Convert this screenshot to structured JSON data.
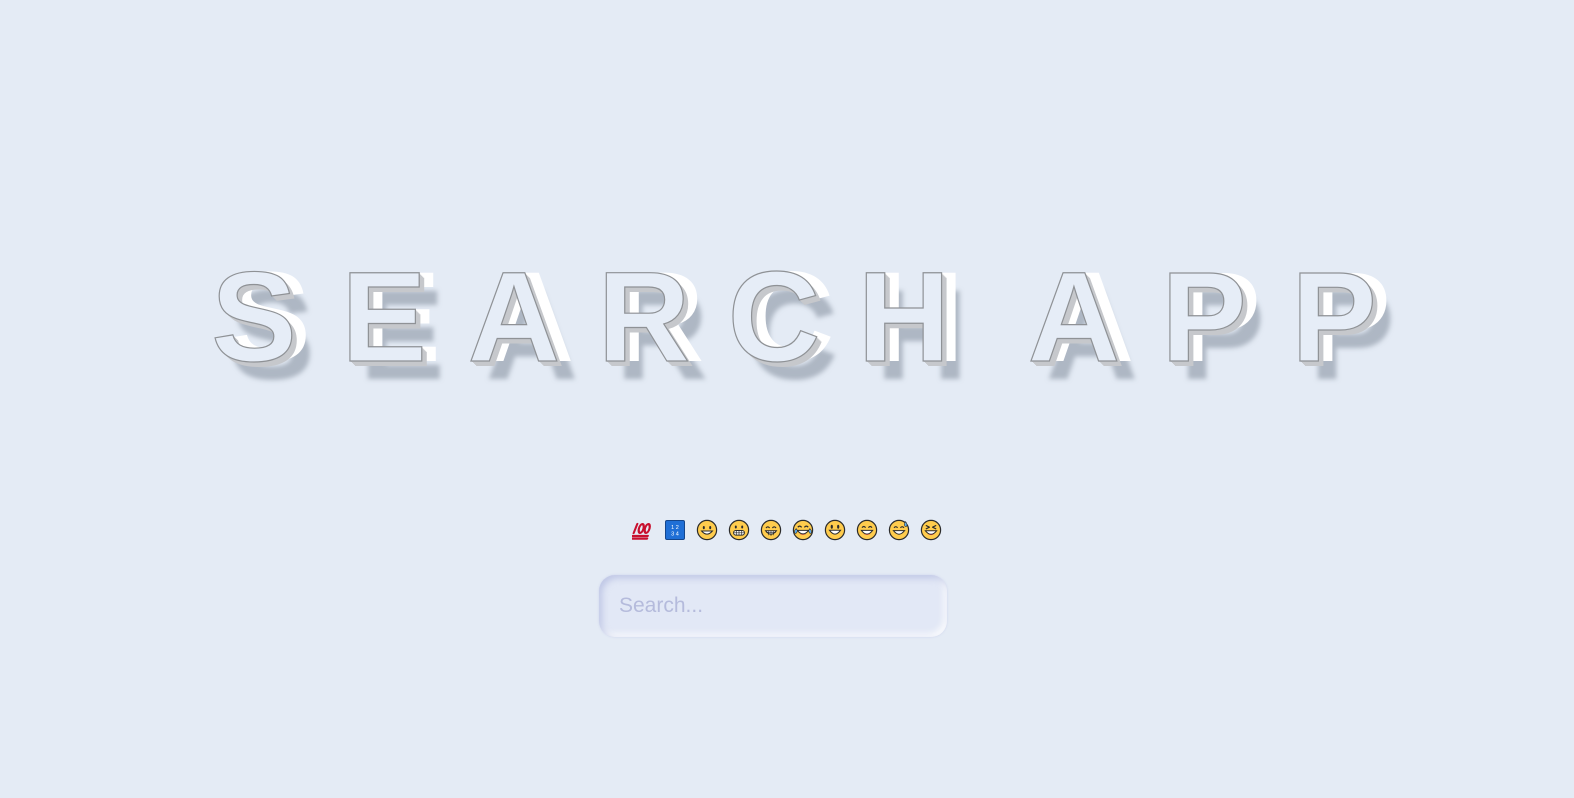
{
  "title": {
    "text": "SEARCH APP",
    "chars": [
      "S",
      "E",
      "A",
      "R",
      "C",
      "H",
      " ",
      "A",
      "P",
      "P"
    ]
  },
  "emoji_bar": {
    "items": [
      {
        "glyph": "💯",
        "icon": "hundred-points-icon"
      },
      {
        "glyph": "🔢",
        "icon": "input-numbers-icon",
        "text": "1234"
      },
      {
        "glyph": "😀",
        "icon": "grinning-face-icon"
      },
      {
        "glyph": "😬",
        "icon": "grimacing-face-icon"
      },
      {
        "glyph": "😁",
        "icon": "beaming-face-icon"
      },
      {
        "glyph": "😂",
        "icon": "tears-of-joy-face-icon"
      },
      {
        "glyph": "😃",
        "icon": "grinning-big-eyes-face-icon"
      },
      {
        "glyph": "😄",
        "icon": "grinning-smiling-eyes-face-icon"
      },
      {
        "glyph": "😅",
        "icon": "grinning-sweat-face-icon"
      },
      {
        "glyph": "😆",
        "icon": "squinting-face-icon"
      }
    ]
  },
  "search": {
    "placeholder": "Search...",
    "value": ""
  },
  "colors": {
    "background": "#e4ebf5",
    "emoji_yellow": "#ffcc4d",
    "emoji_outline": "#2b2b2b",
    "placeholder": "#b5bbdc",
    "hundred_red": "#c8102e",
    "numbers_blue": "#1f6fd6"
  }
}
